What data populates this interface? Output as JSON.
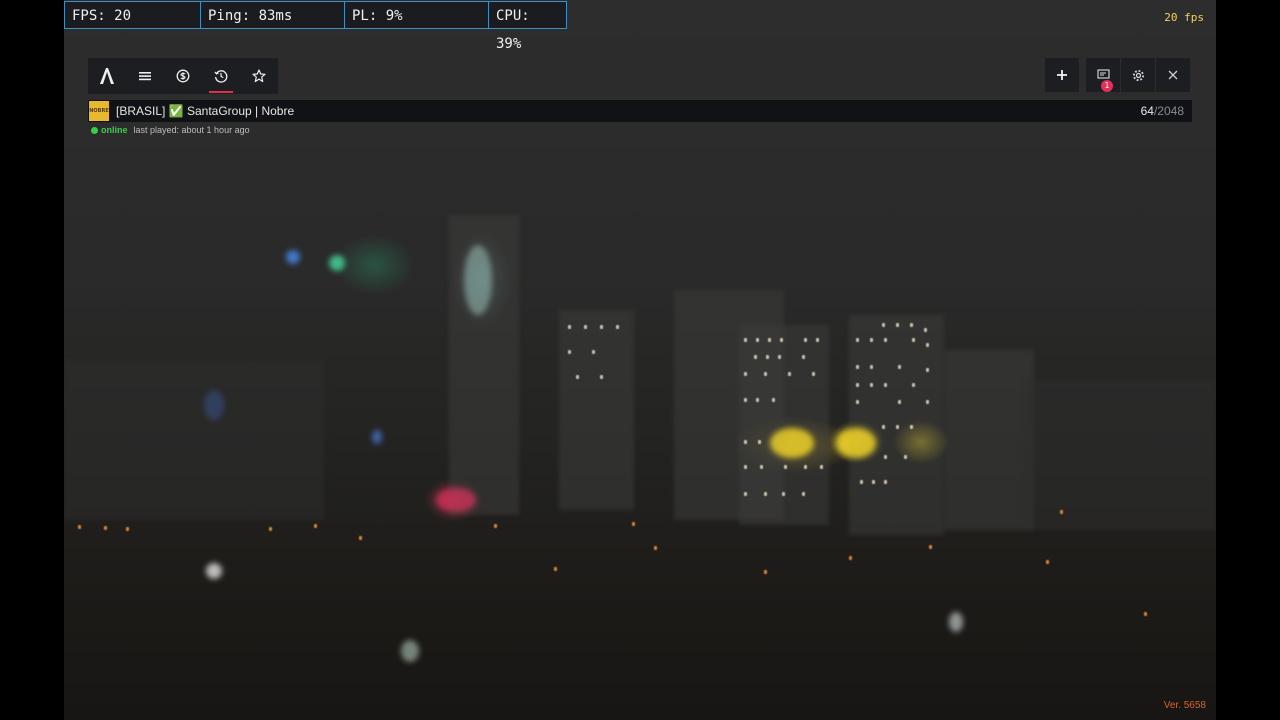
{
  "perf": {
    "fps": "FPS: 20",
    "ping": "Ping: 83ms",
    "pl": "PL: 9%",
    "cpu": "CPU: 39%"
  },
  "fps_corner": "20 fps",
  "nav": {
    "items": [
      {
        "name": "fivem-logo",
        "icon": "fivem-logo-icon"
      },
      {
        "name": "menu",
        "icon": "menu-icon"
      },
      {
        "name": "servers",
        "icon": "server-icon"
      },
      {
        "name": "history",
        "icon": "history-icon",
        "active": true
      },
      {
        "name": "favorites",
        "icon": "star-icon"
      }
    ],
    "accent": "#e0304e"
  },
  "tools": {
    "items": [
      {
        "name": "add",
        "icon": "plus-icon"
      },
      {
        "name": "notifications",
        "icon": "notification-icon",
        "badge": "1"
      },
      {
        "name": "settings",
        "icon": "gear-icon"
      },
      {
        "name": "close",
        "icon": "close-icon"
      }
    ]
  },
  "server": {
    "logo_text": "NOBRE",
    "name": "[BRASIL] ✅ SantaGroup | Nobre",
    "players_current": "64",
    "players_max": "/2048",
    "status": "online",
    "last_played": "last played: about 1 hour ago",
    "status_color": "#35d04a"
  },
  "version": "Ver. 5658"
}
